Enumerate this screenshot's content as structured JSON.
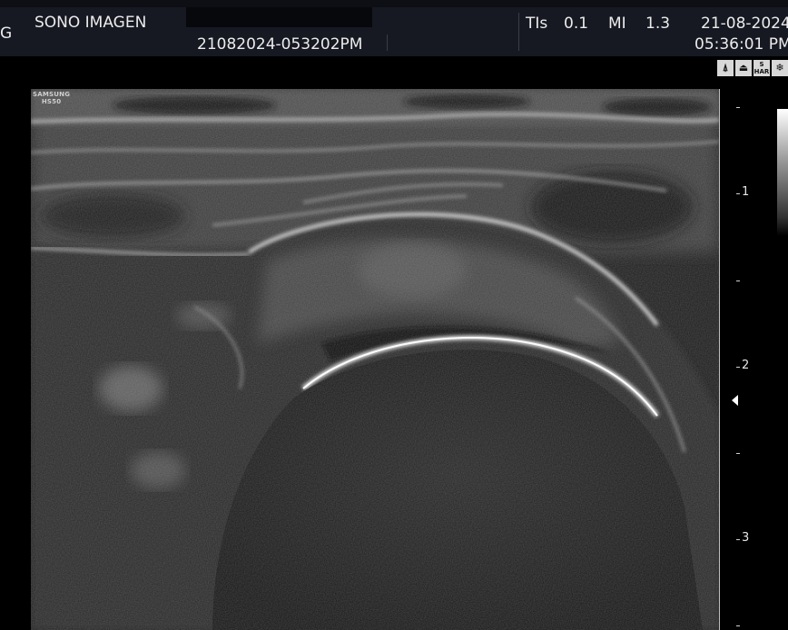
{
  "header": {
    "left_fragment": "G",
    "institution": "SONO IMAGEN",
    "study_id": "21082024-053202PM",
    "tis_label": "TIs",
    "tis_value": "0.1",
    "mi_label": "MI",
    "mi_value": "1.3",
    "date": "21-08-2024",
    "time": "05:36:01 PM"
  },
  "mode_icons": [
    {
      "name": "probe-icon",
      "glyph": "⍋"
    },
    {
      "name": "frame-icon",
      "glyph": "⏏"
    },
    {
      "name": "har-icon",
      "glyph": "S HAR"
    },
    {
      "name": "freeze-icon",
      "glyph": "❄"
    }
  ],
  "brand": {
    "line1": "SAMSUNG",
    "line2": "HS50"
  },
  "depth_scale": {
    "labels": [
      "1",
      "2",
      "3"
    ]
  }
}
